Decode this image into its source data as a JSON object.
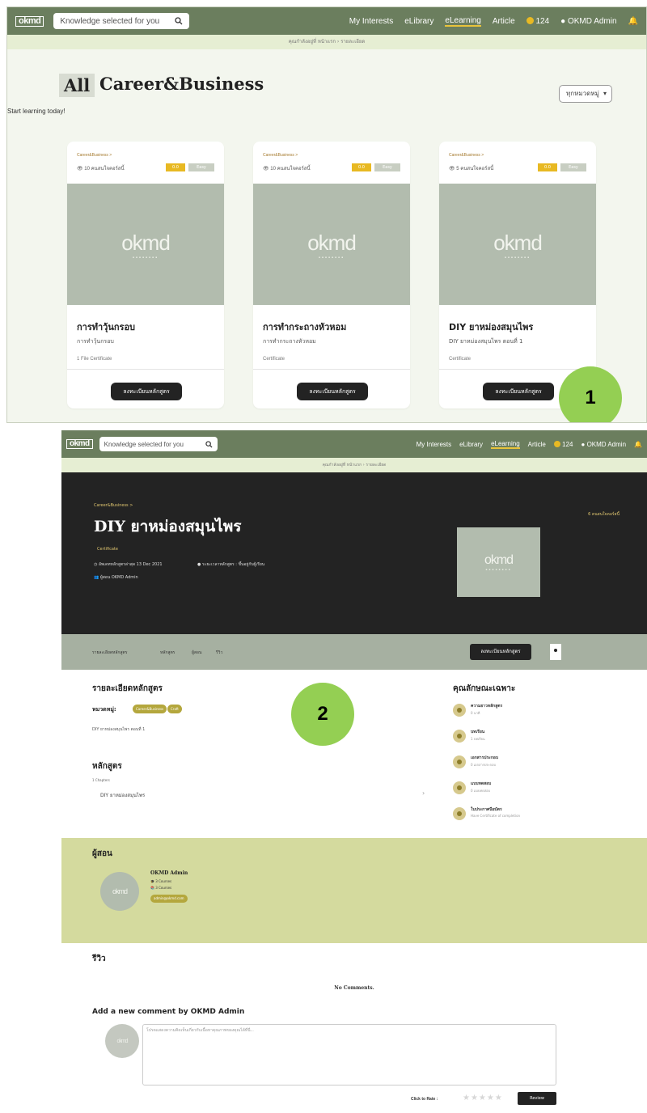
{
  "nav": {
    "logo": "okmd",
    "search_placeholder": "Knowledge selected for you",
    "links": [
      "My Interests",
      "eLibrary",
      "eLearning",
      "Article"
    ],
    "coins": "124",
    "user": "OKMD Admin"
  },
  "page1": {
    "breadcrumb": "คุณกำลังอยู่ที่ หน้าแรก › รายละเอียด",
    "all_label": "All",
    "category_title": "Career&Business",
    "tagline": "Start learning today!",
    "category_select": "ทุกหมวดหมู่",
    "cards": [
      {
        "category": "Career&Business >",
        "views": "10 คนสนใจคอร์สนี้",
        "rating": "0.0",
        "status": "Easy",
        "name": "การทำวุ้นกรอบ",
        "desc": "การทำวุ้นกรอบ",
        "meta": "1 File  Certificate",
        "button": "ลงทะเบียนหลักสูตร"
      },
      {
        "category": "Career&Business >",
        "views": "10 คนสนใจคอร์สนี้",
        "rating": "0.0",
        "status": "Easy",
        "name": "การทำกระถางหัวหอม",
        "desc": "การทำกระถางหัวหอม",
        "meta": "Certificate",
        "button": "ลงทะเบียนหลักสูตร"
      },
      {
        "category": "Career&Business >",
        "views": "5 คนสนใจคอร์สนี้",
        "rating": "0.0",
        "status": "Easy",
        "name": "DIY ยาหม่องสมุนไพร",
        "desc": "DIY ยาหม่องสมุนไพร ตอนที่ 1",
        "meta": "Certificate",
        "button": "ลงทะเบียนหลักสูตร"
      }
    ],
    "step_number": "1"
  },
  "page2": {
    "breadcrumb": "คุณกำลังอยู่ที่ หน้าแรก › รายละเอียด",
    "hero": {
      "category": "Career&Business >",
      "title": "DIY ยาหม่องสมุนไพร",
      "certificate": "Certificate",
      "updated": "อัพเดทหลักสูตรล่าสุด 13 Dec 2021",
      "duration": "ระยะเวลาหลักสูตร : ขึ้นอยู่กับผู้เรียน",
      "instructor": "ผู้สอน OKMD Admin",
      "views": "6 คนสนใจคอร์สนี้"
    },
    "tabs": [
      "รายละเอียดหลักสูตร",
      "หลักสูตร",
      "ผู้สอน",
      "รีวิว"
    ],
    "enroll_button": "ลงทะเบียนหลักสูตร",
    "details": {
      "heading": "รายละเอียดหลักสูตร",
      "category_label": "หมวดหมู่:",
      "tags": [
        "Career&Business",
        "Craft"
      ],
      "description": "DIY ยาหม่องสมุนไพร ตอนที่ 1",
      "curriculum_heading": "หลักสูตร",
      "chapters": "1 Chapters",
      "chapter_item": "DIY ยาหม่องสมุนไพร"
    },
    "features": {
      "heading": "คุณลักษณะเฉพาะ",
      "items": [
        {
          "title": "ความยาวหลักสูตร",
          "sub": "0 นาที"
        },
        {
          "title": "บทเรียน",
          "sub": "1 บทเรียน"
        },
        {
          "title": "เอกสารประกอบ",
          "sub": "0 เอกสารประกอบ"
        },
        {
          "title": "แบบทดสอบ",
          "sub": "0 แบบทดสอบ"
        },
        {
          "title": "ใบประกาศนียบัตร",
          "sub": "Have Certificate of completion"
        }
      ]
    },
    "instructor": {
      "heading": "ผู้สอน",
      "name": "OKMD Admin",
      "courses1": "3 Courses",
      "courses2": "3 Courses",
      "email": "admin@okmd.com"
    },
    "reviews": {
      "heading": "รีวิว",
      "empty": "No Comments.",
      "add_comment": "Add a new comment by OKMD Admin",
      "placeholder": "โปรดแสดงความคิดเห็นเกี่ยวกับเนื้อหาคุณภาพของคุณได้ที่นี่...",
      "click_to_rate": "Click to Rate :",
      "stars": "★★★★★",
      "review_button": "Review"
    },
    "step_number": "2"
  }
}
